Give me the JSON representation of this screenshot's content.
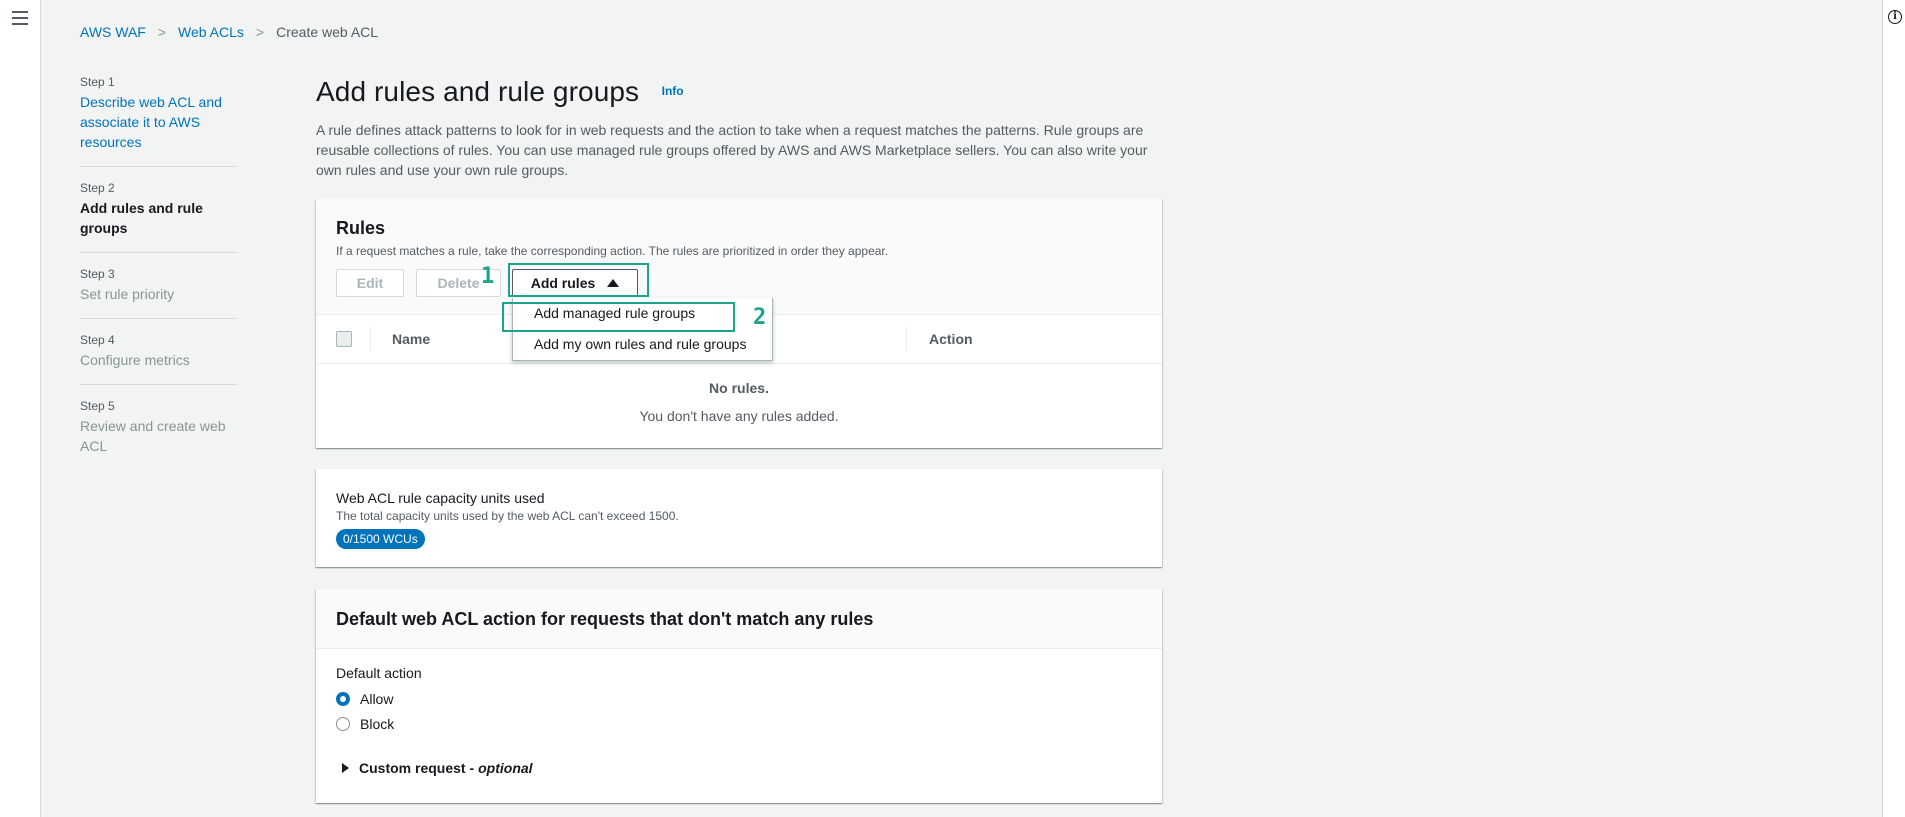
{
  "breadcrumb": {
    "items": [
      "AWS WAF",
      "Web ACLs"
    ],
    "current": "Create web ACL"
  },
  "steps": [
    {
      "num": "Step 1",
      "title": "Describe web ACL and associate it to AWS resources"
    },
    {
      "num": "Step 2",
      "title": "Add rules and rule groups"
    },
    {
      "num": "Step 3",
      "title": "Set rule priority"
    },
    {
      "num": "Step 4",
      "title": "Configure metrics"
    },
    {
      "num": "Step 5",
      "title": "Review and create web ACL"
    }
  ],
  "page": {
    "title": "Add rules and rule groups",
    "info": "Info",
    "description": "A rule defines attack patterns to look for in web requests and the action to take when a request matches the patterns. Rule groups are reusable collections of rules. You can use managed rule groups offered by AWS and AWS Marketplace sellers. You can also write your own rules and use your own rule groups."
  },
  "rules": {
    "title": "Rules",
    "description": "If a request matches a rule, take the corresponding action. The rules are prioritized in order they appear.",
    "edit_label": "Edit",
    "delete_label": "Delete",
    "add_label": "Add rules",
    "columns": [
      "Name",
      "Action"
    ],
    "empty_title": "No rules.",
    "empty_sub": "You don't have any rules added.",
    "dropdown": [
      "Add managed rule groups",
      "Add my own rules and rule groups"
    ]
  },
  "wcu": {
    "title": "Web ACL rule capacity units used",
    "description": "The total capacity units used by the web ACL can't exceed 1500.",
    "badge": "0/1500 WCUs"
  },
  "default_action": {
    "title": "Default web ACL action for requests that don't match any rules",
    "label": "Default action",
    "options": [
      "Allow",
      "Block"
    ],
    "selected": "Allow",
    "custom_request": "Custom request -",
    "optional": "optional"
  },
  "annotations": {
    "marker1": "1",
    "marker2": "2",
    "color": "#1aa58a"
  }
}
